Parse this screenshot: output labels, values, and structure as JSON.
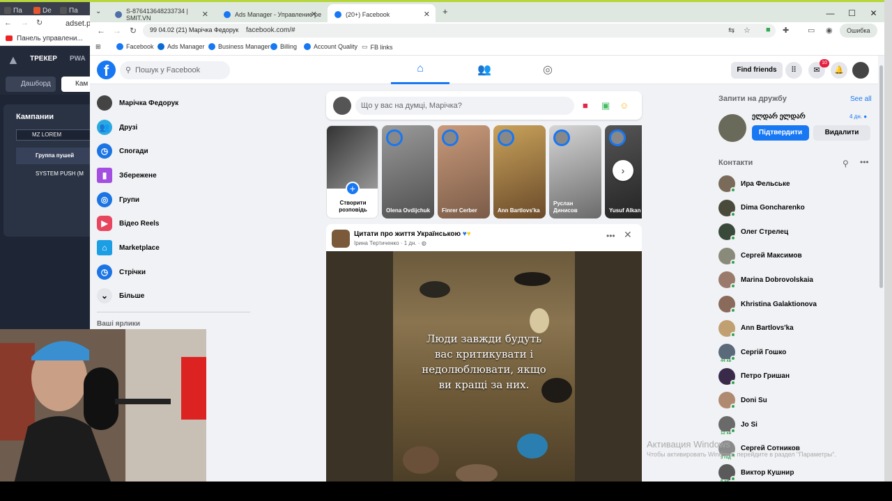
{
  "back_window": {
    "tabs": [
      "Па",
      "De",
      "Па"
    ],
    "address": "adset.pr",
    "bookmark": "Панель управлени...",
    "app_tab_tracker": "ТРЕКЕР",
    "app_tab_pwa": "PWA",
    "dashboard_button": "Дашборд",
    "campaigns_button": "Кам",
    "panel_title": "Кампании",
    "search_value": "MZ LOREM",
    "table_header": "Группа пушей",
    "table_row": "SYSTEM PUSH (M"
  },
  "browser": {
    "tabs": [
      {
        "label": "S-876413648233734 | SMIT.VN"
      },
      {
        "label": "Ads Manager - Управление ре"
      },
      {
        "label": "(20+) Facebook"
      }
    ],
    "site_chip": "99 04.02 (21) Марічка Федорук",
    "url": "facebook.com/#",
    "error_button": "Ошибка",
    "bookmarks": [
      "Facebook",
      "Ads Manager",
      "Business Manager",
      "Billing",
      "Account Quality",
      "FB links"
    ]
  },
  "fb": {
    "search_placeholder": "Пошук у Facebook",
    "find_friends": "Find friends",
    "messenger_badge": "10",
    "left_nav": [
      {
        "label": "Марічка Федорук"
      },
      {
        "label": "Друзі"
      },
      {
        "label": "Спогади"
      },
      {
        "label": "Збережене"
      },
      {
        "label": "Групи"
      },
      {
        "label": "Відео Reels"
      },
      {
        "label": "Marketplace"
      },
      {
        "label": "Стрічки"
      },
      {
        "label": "Більше"
      }
    ],
    "shortcuts_title": "Ваші ярлики",
    "composer_placeholder": "Що у вас на думці, Марічка?",
    "stories": [
      {
        "name": "Створити розповідь"
      },
      {
        "name": "Olena Ovdijchuk"
      },
      {
        "name": "Finrer Cerber"
      },
      {
        "name": "Ann Bartlovs'ka"
      },
      {
        "name": "Руслан Динисов"
      },
      {
        "name": "Yusuf Alkan"
      }
    ],
    "post": {
      "page": "Цитати про життя Українською",
      "author": "Ірина Тертиченко",
      "time": "1 дн.",
      "quote": "Люди завжди будуть вас критикувати і недолюблювати, якщо ви кращі за них."
    },
    "requests": {
      "title": "Запити на дружбу",
      "see_all": "See all",
      "name": "ელდარ ელდარ",
      "time": "4 дн.",
      "confirm": "Підтвердити",
      "delete": "Видалити"
    },
    "contacts_title": "Контакти",
    "contacts": [
      {
        "name": "Ира Фельське",
        "meta": ""
      },
      {
        "name": "Dima Goncharenko",
        "meta": ""
      },
      {
        "name": "Олег Стрелец",
        "meta": ""
      },
      {
        "name": "Сергей Максимов",
        "meta": ""
      },
      {
        "name": "Marina Dobrovolskaia",
        "meta": ""
      },
      {
        "name": "Khristina Galaktionova",
        "meta": ""
      },
      {
        "name": "Ann Bartlovs'ka",
        "meta": ""
      },
      {
        "name": "Сергій Гошко",
        "meta": "44 хв"
      },
      {
        "name": "Петро Гришан",
        "meta": ""
      },
      {
        "name": "Doni Su",
        "meta": ""
      },
      {
        "name": "Jo Si",
        "meta": "12 хв"
      },
      {
        "name": "Сергей Сотников",
        "meta": "3 год"
      },
      {
        "name": "Виктор Кушнир",
        "meta": "6 хв"
      }
    ],
    "watermark_title": "Активация Windows",
    "watermark_sub": "Чтобы активировать Windows, перейдите в раздел \"Параметры\"."
  },
  "colors": {
    "fb_blue": "#1877f2",
    "online": "#31a24c"
  }
}
